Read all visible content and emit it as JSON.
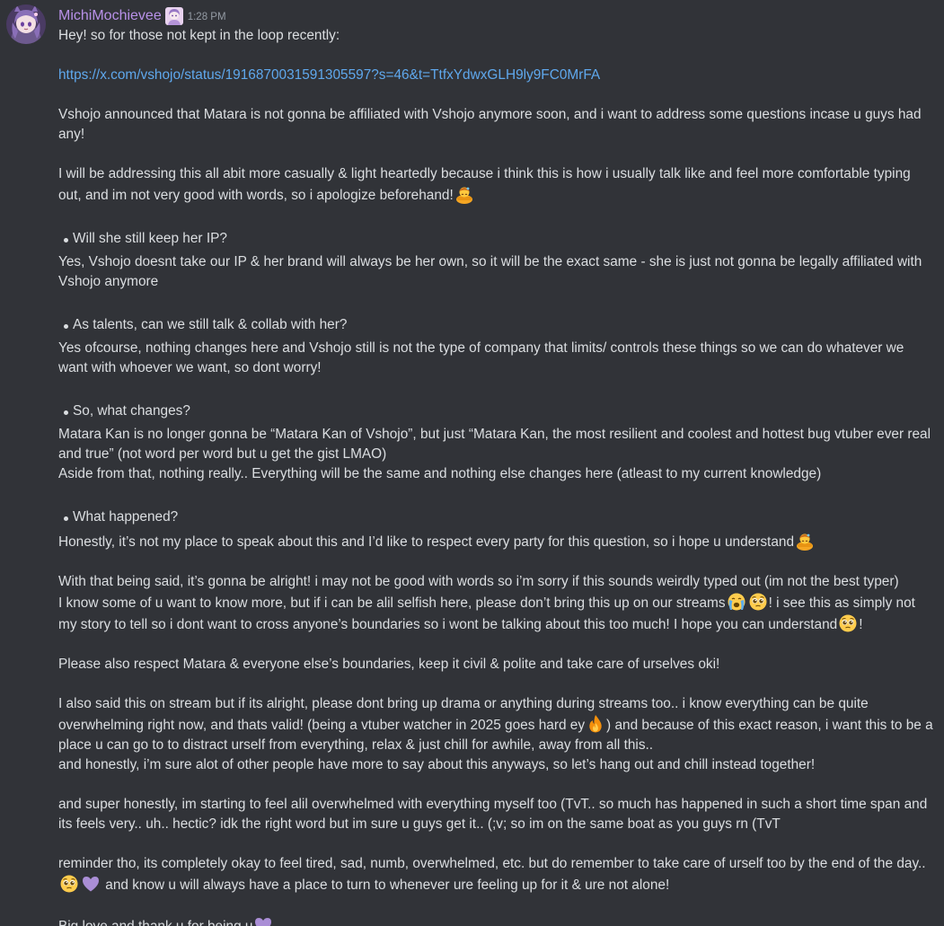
{
  "author": {
    "username": "MichiMochievee",
    "timestamp": "1:28 PM",
    "avatar_icon": "avatar-purple-catgirl",
    "name_color": "#b891e8"
  },
  "message": {
    "intro": "Hey! so for those not kept in the loop recently:",
    "link": "https://x.com/vshojo/status/1916870031591305597?s=46&t=TtfxYdwxGLH9ly9FC0MrFA",
    "announcement": "Vshojo announced that Matara is not gonna be affiliated with Vshojo anymore soon, and i want to address some questions incase u guys had any!",
    "casual_note": "I will be addressing this all abit more casually & light heartedly because i think this is how i usually talk like and feel more comfortable typing out, and im not very good with words, so i apologize beforehand!",
    "q1": "Will she still keep her IP?",
    "a1": "Yes, Vshojo doesnt take our IP & her brand will always be her own, so it will be the exact same - she is just not gonna be legally affiliated with Vshojo anymore",
    "q2": "As talents, can we still talk & collab with her?",
    "a2": "Yes ofcourse, nothing changes here and Vshojo still is not the type of company that limits/ controls these things so we can do whatever we want with whoever we want, so dont worry!",
    "q3": "So, what changes?",
    "a3_line1": "Matara Kan is no longer gonna be “Matara Kan of Vshojo”, but just “Matara Kan, the most resilient and coolest and hottest bug vtuber ever real and true” (not word per word but u get the gist LMAO)",
    "a3_line2": "Aside from that, nothing really.. Everything will be the same and nothing else changes here (atleast to my current knowledge)",
    "q4": "What happened?",
    "a4": "Honestly, it’s not my place to speak about this and I’d like to respect every party for this question, so i hope u understand",
    "p_alright": "With that being said, it’s gonna be alright! i may not be good with words so i’m sorry if this sounds weirdly typed out (im not the best typer)",
    "p_selfish_a": "I know some of u want to know more, but if i can be alil selfish here, please don’t bring this up on our streams",
    "p_selfish_b": "! i see this as simply not my story to tell so i dont want to cross anyone’s boundaries so i wont be talking about this too much! I hope you can understand",
    "p_selfish_c": "!",
    "p_respect": "Please also respect Matara & everyone else’s boundaries, keep it civil & polite and take care of urselves oki!",
    "p_stream_a": "I also said this on stream but if its alright, please dont bring up drama or anything during streams too.. i know everything can be quite overwhelming right now, and thats valid! (being a vtuber watcher in 2025 goes hard ey",
    "p_stream_b": ") and because of this exact reason, i want this to be a place u can go to to distract urself from everything, relax & just chill for awhile, away from all this..",
    "p_stream_c": "and honestly, i’m sure alot of other people have more to say about this anyways, so let’s hang out and chill instead together!",
    "p_honest": "and super honestly, im starting to feel alil overwhelmed with everything myself too (TvT.. so much has happened in such a short time span and its feels very.. uh.. hectic? idk the right word but im sure u guys get it.. (;v; so im on the same boat as you guys rn (TvT",
    "p_reminder_a": "reminder tho, its completely okay to feel tired, sad, numb, overwhelmed, etc. but do remember to take care of urself too by the end of the day..",
    "p_reminder_b": " and know u will always have a place to turn to whenever ure feeling up for it & ure not alone!",
    "p_love": "Big love and thank u for being u"
  },
  "emojis": {
    "bow": "person-bowing-emoji",
    "crying": "loudly-crying-face-emoji",
    "pleading": "pleading-face-emoji",
    "fire": "fire-emoji",
    "purple_heart": "purple-heart-emoji"
  },
  "colors": {
    "background": "#313338",
    "text": "#dbdee1",
    "link": "#5fa8ed",
    "timestamp": "#949ba4"
  }
}
